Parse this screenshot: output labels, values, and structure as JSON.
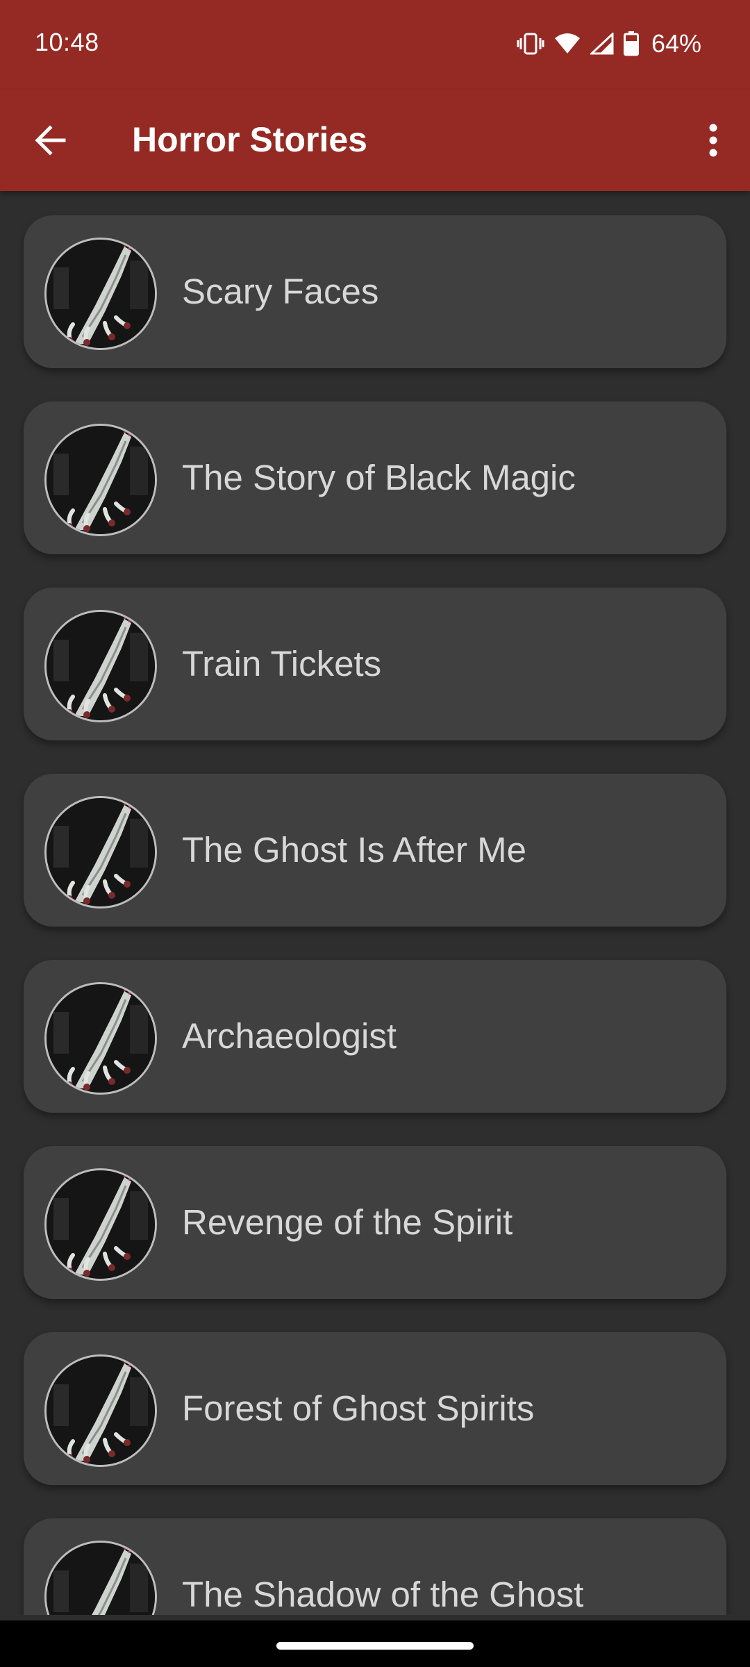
{
  "status": {
    "time": "10:48",
    "battery": "64%",
    "icons": [
      "vibrate-icon",
      "wifi-icon",
      "signal-icon",
      "battery-icon"
    ]
  },
  "appbar": {
    "title": "Horror Stories",
    "back_icon": "arrow-left-icon",
    "menu_icon": "more-vert-icon"
  },
  "stories": [
    {
      "title": "Scary Faces"
    },
    {
      "title": "The Story of Black Magic"
    },
    {
      "title": "Train Tickets"
    },
    {
      "title": "The Ghost Is After Me"
    },
    {
      "title": "Archaeologist"
    },
    {
      "title": "Revenge of the Spirit"
    },
    {
      "title": "Forest of Ghost Spirits"
    },
    {
      "title": "The Shadow of the Ghost"
    }
  ],
  "colors": {
    "appbar": "#952a24",
    "background": "#2e2e2e",
    "card": "#404040",
    "card_text": "#d8d8d8"
  }
}
